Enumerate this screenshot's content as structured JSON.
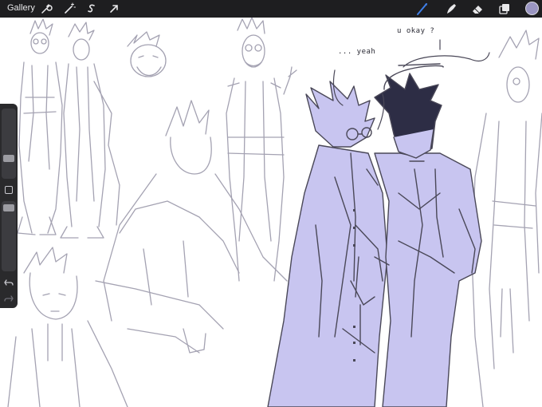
{
  "toolbar": {
    "gallery_label": "Gallery",
    "left_tools": [
      "wrench-icon",
      "magic-wand-icon",
      "selection-icon",
      "transform-arrow-icon"
    ],
    "right_tools": [
      "brush-icon",
      "smudge-icon",
      "eraser-icon",
      "layers-icon"
    ],
    "active_tool": "brush-icon",
    "active_tool_color": "#3f7fe8",
    "current_color": "#9a95c2"
  },
  "sidebar": {
    "brush_size_label": "",
    "opacity_label": ""
  },
  "canvas": {
    "speech_yeah": "... yeah",
    "speech_okay": "u okay ?",
    "fill_color": "#c8c5f0",
    "line_color": "#4a4858",
    "sketch_color": "#9a98a8"
  }
}
